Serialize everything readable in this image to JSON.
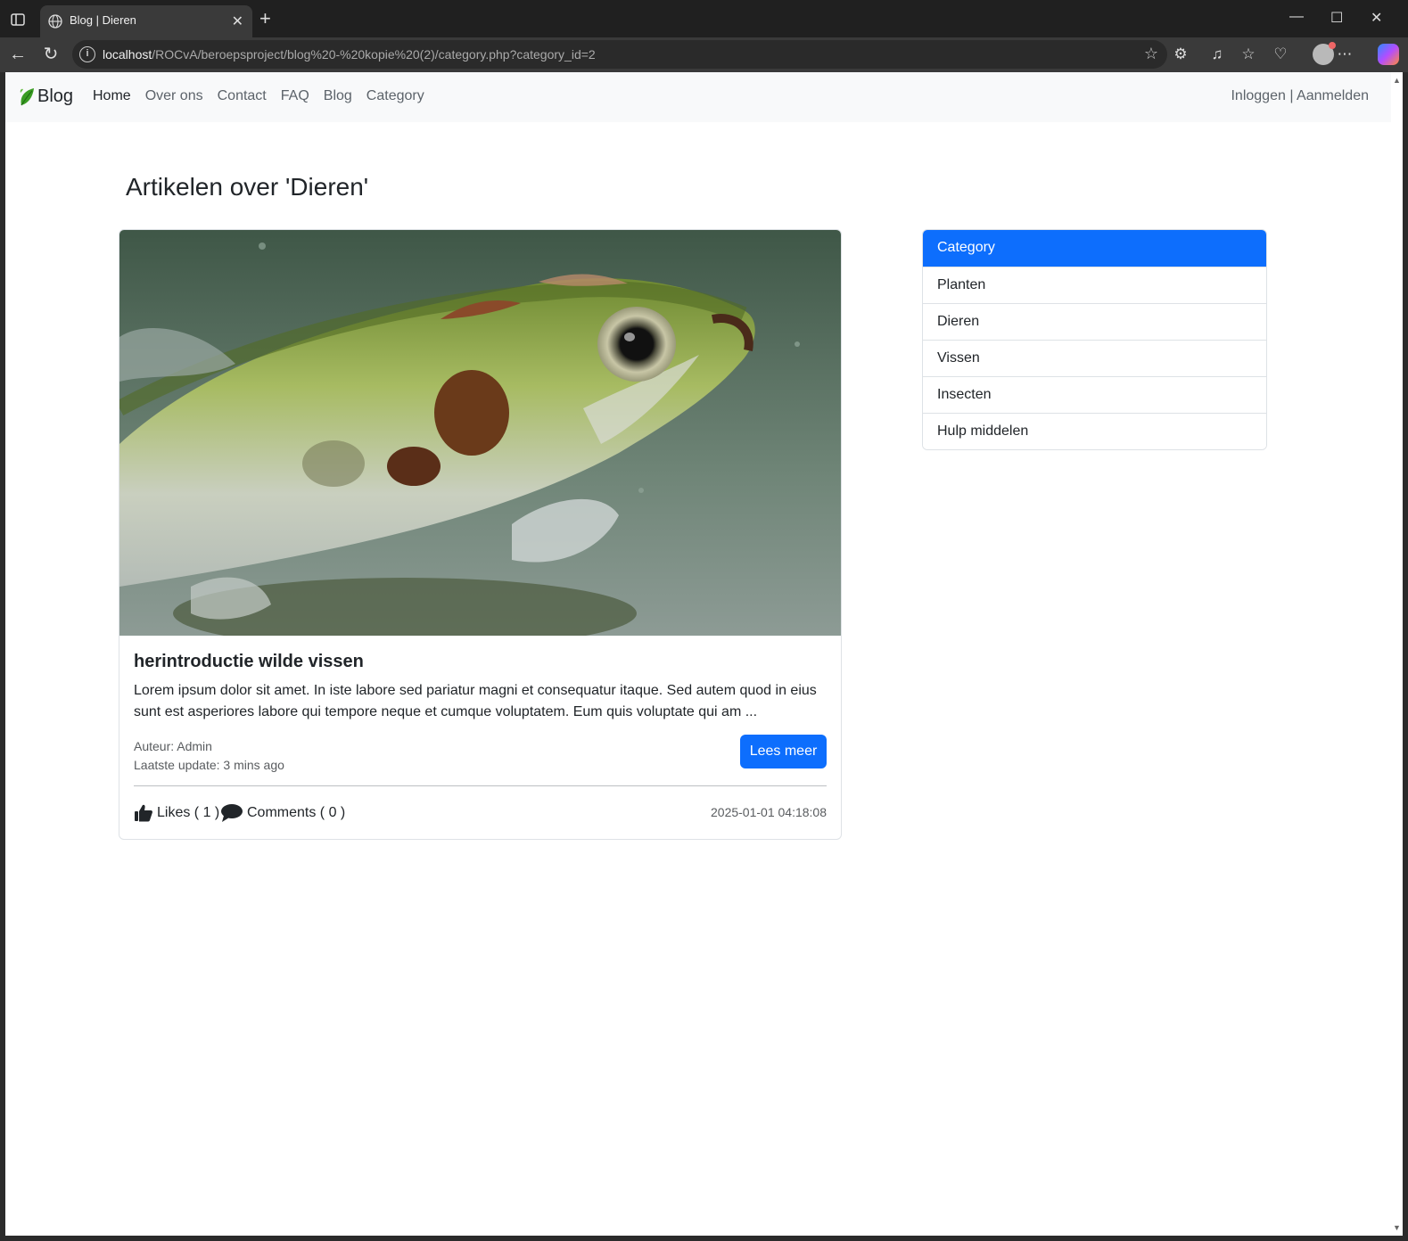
{
  "browser": {
    "tab_title": "Blog | Dieren",
    "url_host": "localhost",
    "url_path": "/ROCvA/beroepsproject/blog%20-%20kopie%20(2)/category.php?category_id=2"
  },
  "navbar": {
    "brand": "Blog",
    "links": [
      "Home",
      "Over ons",
      "Contact",
      "FAQ",
      "Blog",
      "Category"
    ],
    "login": "Inloggen",
    "separator": "|",
    "register": "Aanmelden"
  },
  "page": {
    "heading": "Artikelen over 'Dieren'"
  },
  "article": {
    "title": "herintroductie wilde vissen",
    "excerpt": "Lorem ipsum dolor sit amet. In iste labore sed pariatur magni et consequatur itaque. Sed autem quod in eius sunt est asperiores labore qui tempore neque et cumque voluptatem. Eum quis voluptate qui am ...",
    "author": "Auteur: Admin",
    "updated": "Laatste update: 3 mins ago",
    "read_more": "Lees meer",
    "likes": "Likes ( 1 )",
    "comments": "Comments ( 0 )",
    "date": "2025-01-01 04:18:08",
    "image_icon": "fish-photo"
  },
  "sidebar": {
    "items": [
      "Category",
      "Planten",
      "Dieren",
      "Vissen",
      "Insecten",
      "Hulp middelen"
    ]
  },
  "colors": {
    "primary": "#0d6efd",
    "navbar_bg": "#f8f9fa"
  }
}
